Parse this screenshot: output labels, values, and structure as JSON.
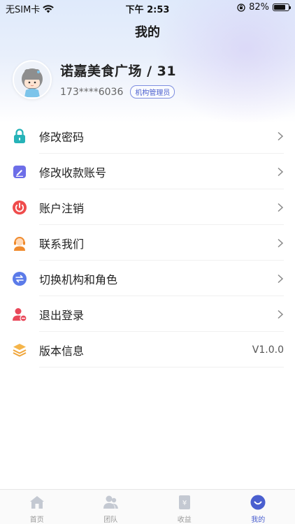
{
  "status_bar": {
    "carrier": "无SIM卡",
    "time": "下午 2:53",
    "battery_percent": "82%",
    "battery_level": 0.82
  },
  "page": {
    "title": "我的"
  },
  "profile": {
    "org_name": "诺嘉美食广场 / 31",
    "phone": "173****6036",
    "role": "机构管理员"
  },
  "menu": {
    "items": [
      {
        "label": "修改密码",
        "icon": "lock-icon",
        "color": "#26b3b8"
      },
      {
        "label": "修改收款账号",
        "icon": "edit-icon",
        "color": "#6d6ee8"
      },
      {
        "label": "账户注销",
        "icon": "power-icon",
        "color": "#ef4b4b"
      },
      {
        "label": "联系我们",
        "icon": "customer-service-icon",
        "color": "#f08a2c"
      },
      {
        "label": "切换机构和角色",
        "icon": "switch-icon",
        "color": "#5b7be9"
      },
      {
        "label": "退出登录",
        "icon": "logout-user-icon",
        "color": "#e9485a"
      },
      {
        "label": "版本信息",
        "icon": "layers-icon",
        "color": "#f0a53a",
        "value": "V1.0.0"
      }
    ]
  },
  "tabbar": {
    "tabs": [
      {
        "label": "首页",
        "icon": "home-icon"
      },
      {
        "label": "团队",
        "icon": "team-icon"
      },
      {
        "label": "收益",
        "icon": "earnings-icon"
      },
      {
        "label": "我的",
        "icon": "profile-icon",
        "active": true
      }
    ],
    "active_color": "#4a5fcf",
    "inactive_color": "#c4c9d2"
  }
}
